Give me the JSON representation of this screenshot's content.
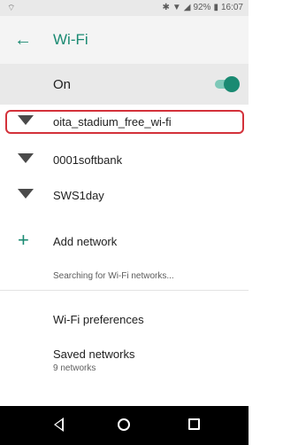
{
  "status_bar": {
    "left_icon": "wifi-signal-icon",
    "right_icons": [
      "bluetooth-icon",
      "wifi-icon",
      "4g-signal-icon"
    ],
    "battery": "92%",
    "time": "16:07"
  },
  "app_bar": {
    "title": "Wi-Fi",
    "back_icon": "arrow-left-icon"
  },
  "wifi_toggle": {
    "label": "On",
    "enabled": true
  },
  "networks": [
    {
      "name": "oita_stadium_free_wi-fi",
      "highlighted": true
    },
    {
      "name": "0001softbank"
    },
    {
      "name": "SWS1day"
    }
  ],
  "add_network": {
    "label": "Add network"
  },
  "searching_text": "Searching for Wi-Fi networks...",
  "wifi_preferences": {
    "label": "Wi-Fi preferences"
  },
  "saved_networks": {
    "label": "Saved networks",
    "subtitle": "9 networks"
  },
  "nav_bar": {
    "buttons": [
      "back-icon",
      "home-icon",
      "recents-icon"
    ]
  },
  "colors": {
    "accent": "#1a8a72",
    "highlight": "#d3313a"
  }
}
